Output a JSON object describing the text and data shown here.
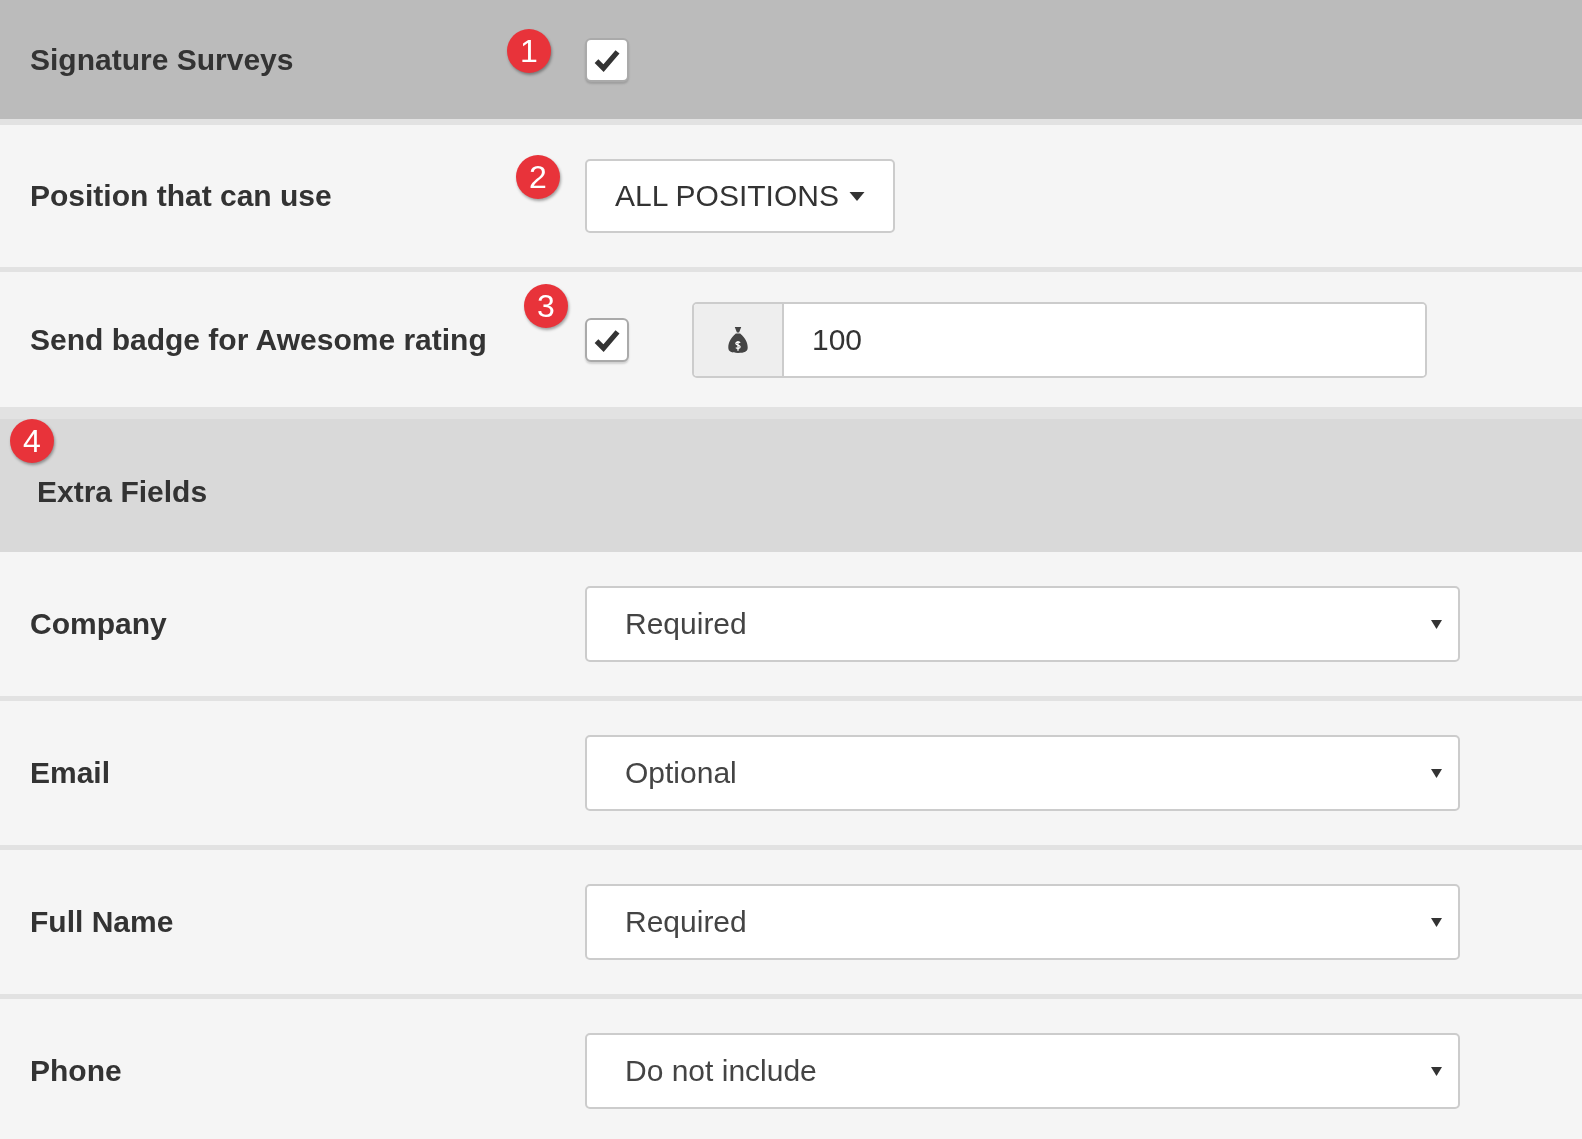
{
  "rows": [
    {
      "kind": "toggle-header",
      "label": "Signature Surveys",
      "badge": "1",
      "checked": true
    },
    {
      "kind": "dropdown-button",
      "label": "Position that can use",
      "badge": "2",
      "value": "ALL POSITIONS"
    },
    {
      "kind": "checkbox-amount",
      "label": "Send badge for Awesome rating",
      "badge": "3",
      "checked": true,
      "amount": "100"
    },
    {
      "kind": "section-header",
      "label": "Extra Fields",
      "badge": "4"
    },
    {
      "kind": "select",
      "label": "Company",
      "value": "Required"
    },
    {
      "kind": "select",
      "label": "Email",
      "value": "Optional"
    },
    {
      "kind": "select",
      "label": "Full Name",
      "value": "Required"
    },
    {
      "kind": "select",
      "label": "Phone",
      "value": "Do not include"
    }
  ]
}
